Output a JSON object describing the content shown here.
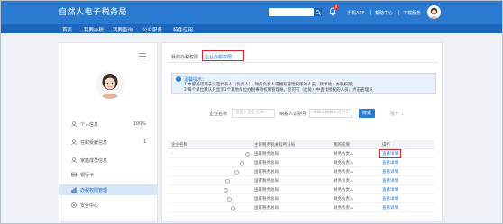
{
  "header": {
    "title": "自然人电子税务局",
    "search_placeholder": "",
    "bell_badge": "4",
    "links": [
      "手机APP",
      "帮助中心",
      "下载服务"
    ]
  },
  "nav": {
    "items": [
      "首页",
      "我要办税",
      "我要查询",
      "公众服务",
      "特色应用"
    ]
  },
  "sidebar": {
    "items": [
      {
        "label": "个人信息",
        "value": "100%",
        "icon": "user-icon"
      },
      {
        "label": "任职受雇信息",
        "value": "1",
        "icon": "user-icon"
      },
      {
        "label": "家庭成员信息",
        "value": "",
        "icon": "user-icon"
      },
      {
        "label": "银行卡",
        "value": "",
        "icon": "card-icon"
      },
      {
        "label": "办税权限管理",
        "value": "",
        "icon": "chart-icon"
      },
      {
        "label": "安全中心",
        "value": "",
        "icon": "shield-icon"
      }
    ]
  },
  "main": {
    "tabs": [
      "我的办税权限",
      "企业办税权限"
    ],
    "notice": {
      "title": "温馨提示：",
      "lines": [
        "1.本服务适用于法定代表人（负责人），财务负责人或拥有管理权限的人员，赋予他人办税权限；",
        "2.每个单位默认只显示1个其他单位办税事项权限管理账，您可在（此处）中查找授权的人员，点击管理员"
      ]
    },
    "filters": {
      "company_label": "企业名称",
      "company_placeholder": "请输入企业名称",
      "taxid_label": "纳税人识别号",
      "taxid_placeholder": "请输入纳税人识别号",
      "search_button": "搜索",
      "more_button": "展开 ⌄"
    },
    "table": {
      "headers": [
        "企业名称",
        "主管税务机关科所分局",
        "我的权限",
        "操作"
      ],
      "rows": [
        {
          "company": "-",
          "office": "国家税务总局",
          "perm": "财务负责人",
          "action": "查看详情"
        },
        {
          "company": "",
          "office": "国家税务总局",
          "perm": "财务负责人",
          "action": "查看详情"
        },
        {
          "company": "",
          "office": "国家税务总局",
          "perm": "财务负责人",
          "action": "查看详情"
        },
        {
          "company": "",
          "office": "国家税务总局",
          "perm": "财务负责人",
          "action": "查看详情"
        },
        {
          "company": "",
          "office": "国家税务总局",
          "perm": "财务负责人",
          "action": "查看详情"
        },
        {
          "company": "",
          "office": "国家税务总局",
          "perm": "财务负责人",
          "action": "查看详情"
        },
        {
          "company": "",
          "office": "国家税务总局",
          "perm": "财务负责人",
          "action": "查看详情"
        }
      ]
    }
  },
  "colors": {
    "header_blue": "#2a7ad2",
    "nav_blue": "#1d66bf",
    "highlight_red": "#d9232d"
  }
}
